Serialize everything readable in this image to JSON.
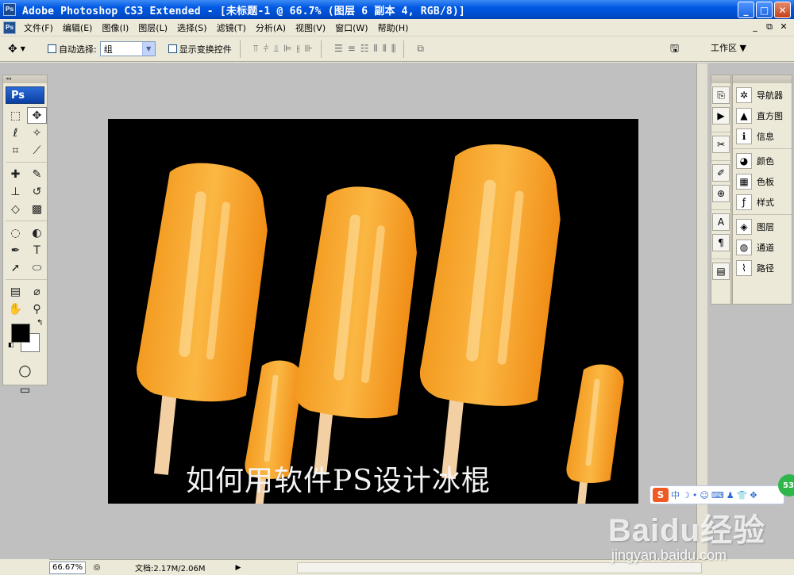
{
  "window": {
    "title": "Adobe Photoshop CS3 Extended - [未标题-1 @ 66.7% (图层 6 副本 4, RGB/8)]",
    "app_icon": "Ps",
    "buttons": {
      "minimize": "_",
      "maximize": "□",
      "close": "✕"
    }
  },
  "menu": {
    "items": [
      "文件(F)",
      "编辑(E)",
      "图像(I)",
      "图层(L)",
      "选择(S)",
      "滤镜(T)",
      "分析(A)",
      "视图(V)",
      "窗口(W)",
      "帮助(H)"
    ],
    "mdi": {
      "minimize": "_",
      "restore": "⧉",
      "close": "✕"
    }
  },
  "options": {
    "auto_select_label": "自动选择:",
    "auto_select_value": "组",
    "show_transform_label": "显示变换控件",
    "workspace_label": "工作区 ▼"
  },
  "tools": {
    "logo": "Ps",
    "items": [
      {
        "name": "marquee-tool-icon",
        "glyph": "⬚"
      },
      {
        "name": "move-tool-icon",
        "glyph": "✥",
        "active": true
      },
      {
        "name": "lasso-tool-icon",
        "glyph": "ℓ"
      },
      {
        "name": "magic-wand-icon",
        "glyph": "✧"
      },
      {
        "name": "crop-tool-icon",
        "glyph": "⌗"
      },
      {
        "name": "slice-tool-icon",
        "glyph": "⟋"
      },
      {
        "name": "healing-brush-icon",
        "glyph": "✚"
      },
      {
        "name": "brush-tool-icon",
        "glyph": "✎"
      },
      {
        "name": "clone-stamp-icon",
        "glyph": "⊥"
      },
      {
        "name": "history-brush-icon",
        "glyph": "↺"
      },
      {
        "name": "eraser-tool-icon",
        "glyph": "◇"
      },
      {
        "name": "gradient-tool-icon",
        "glyph": "▩"
      },
      {
        "name": "blur-tool-icon",
        "glyph": "◌"
      },
      {
        "name": "dodge-tool-icon",
        "glyph": "◐"
      },
      {
        "name": "pen-tool-icon",
        "glyph": "✒"
      },
      {
        "name": "type-tool-icon",
        "glyph": "T"
      },
      {
        "name": "path-select-icon",
        "glyph": "➚"
      },
      {
        "name": "ellipse-tool-icon",
        "glyph": "⬭"
      },
      {
        "name": "notes-tool-icon",
        "glyph": "▤"
      },
      {
        "name": "eyedropper-icon",
        "glyph": "⌀"
      },
      {
        "name": "hand-tool-icon",
        "glyph": "✋"
      },
      {
        "name": "zoom-tool-icon",
        "glyph": "⚲"
      }
    ]
  },
  "canvas": {
    "caption": "如何用软件PS设计冰棍",
    "background": "#000000",
    "popsicle_color": "#f6a430",
    "stick_color": "#f3cfa4"
  },
  "panels": {
    "groups": [
      [
        {
          "label": "导航器",
          "icon": "navigator-icon",
          "glyph": "✲"
        },
        {
          "label": "直方图",
          "icon": "histogram-icon",
          "glyph": "▲"
        },
        {
          "label": "信息",
          "icon": "info-icon",
          "glyph": "ℹ"
        }
      ],
      [
        {
          "label": "颜色",
          "icon": "color-icon",
          "glyph": "◕"
        },
        {
          "label": "色板",
          "icon": "swatches-icon",
          "glyph": "▦"
        },
        {
          "label": "样式",
          "icon": "styles-icon",
          "glyph": "ƒ"
        }
      ],
      [
        {
          "label": "图层",
          "icon": "layers-icon",
          "glyph": "◈"
        },
        {
          "label": "通道",
          "icon": "channels-icon",
          "glyph": "◍"
        },
        {
          "label": "路径",
          "icon": "paths-icon",
          "glyph": "⌇"
        }
      ]
    ],
    "dock_icons": [
      "history-icon",
      "actions-icon",
      "tool-presets-icon",
      "brushes-icon",
      "clone-source-icon",
      "character-icon",
      "paragraph-icon",
      "layer-comps-icon"
    ]
  },
  "status": {
    "zoom": "66.67%",
    "doc_info": "文档:2.17M/2.06M"
  },
  "ime": {
    "logo": "S",
    "mode": "中"
  },
  "watermark": {
    "main": "Baidu经验",
    "sub": "jingyan.baidu.com"
  }
}
